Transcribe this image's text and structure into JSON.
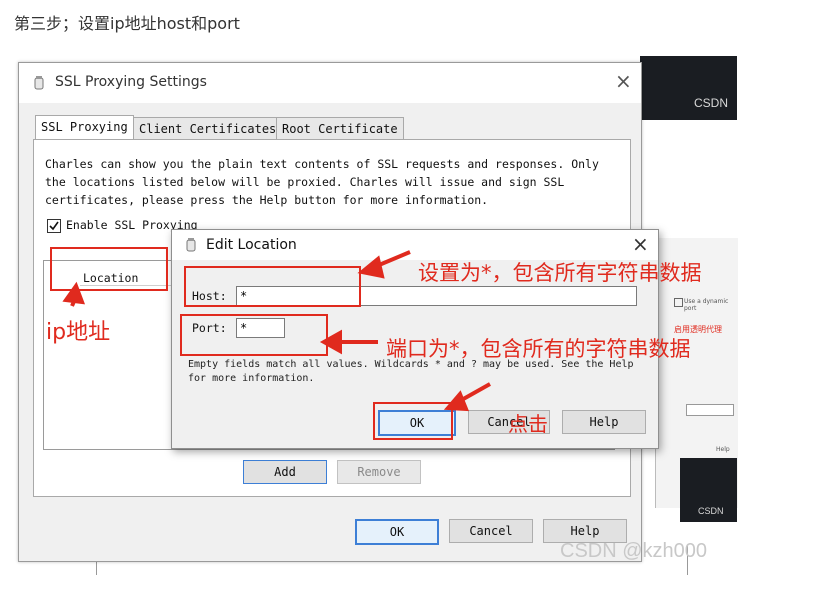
{
  "caption": "第三步；设置ip地址host和port",
  "background": {
    "csdn_top": "CSDN",
    "csdn_bottom": "CSDN"
  },
  "ssl_window": {
    "title": "SSL Proxying Settings",
    "close_glyph": "×",
    "tabs": [
      "SSL Proxying",
      "Client Certificates",
      "Root Certificate"
    ],
    "description": "Charles can show you the plain text contents of SSL requests and responses. Only the locations listed below will be proxied. Charles will issue and sign SSL certificates, please press the Help button for more information.",
    "enable_label": "Enable SSL Proxying",
    "enable_checked": true,
    "table_header": "Location",
    "add_label": "Add",
    "remove_label": "Remove",
    "ok_label": "OK",
    "cancel_label": "Cancel",
    "help_label": "Help"
  },
  "edit_dialog": {
    "title": "Edit Location",
    "close_glyph": "×",
    "host_label": "Host:",
    "host_value": "*",
    "port_label": "Port:",
    "port_value": "*",
    "hint": "Empty fields match all values. Wildcards * and ? may be used. See the Help for more information.",
    "ok_label": "OK",
    "cancel_label": "Cancel",
    "help_label": "Help"
  },
  "annotations": {
    "host_note": "设置为*，包含所有字符串数据",
    "port_note": "端口为*，包含所有的字符串数据",
    "location_note": "ip地址",
    "click_note": "点击",
    "color": "#e02a1e"
  },
  "right_fragment": {
    "dynamic_port": "Use a dynamic port",
    "proxy_note": "启用透明代理",
    "help": "Help"
  },
  "watermark": "CSDN @kzh000"
}
